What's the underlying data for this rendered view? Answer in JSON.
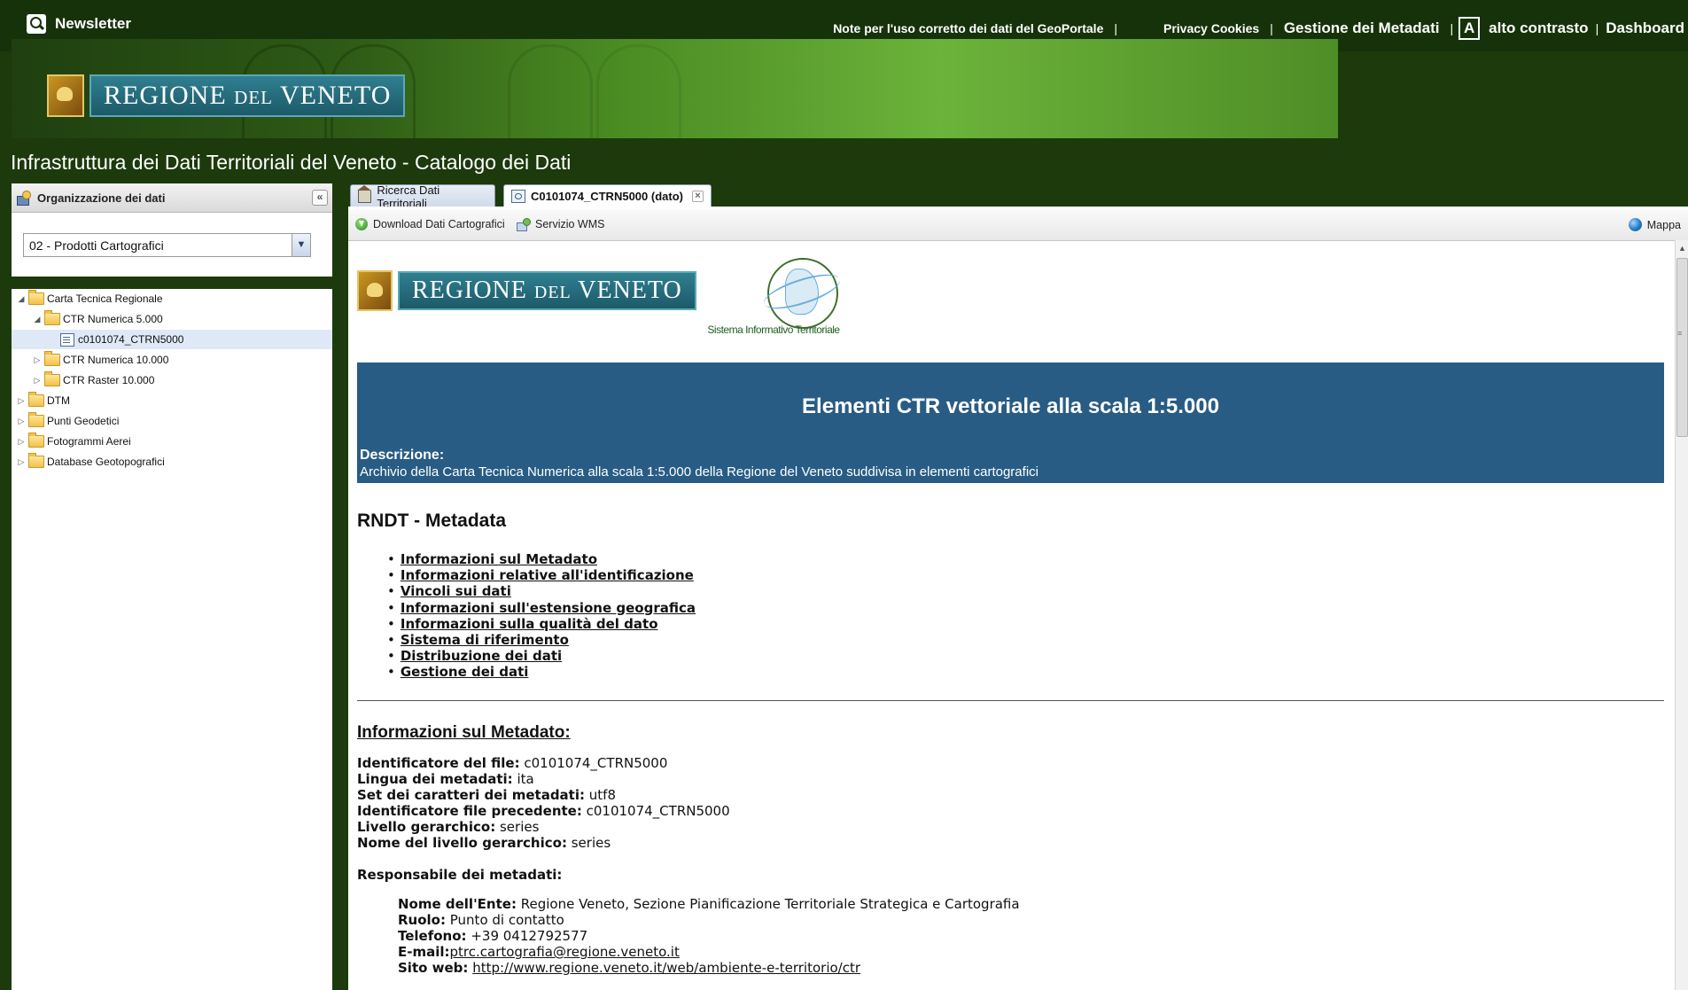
{
  "topbar": {
    "newsletter": "Newsletter",
    "links": [
      "Note per l'uso corretto dei dati del GeoPortale",
      "Privacy Cookies",
      "Gestione dei Metadati",
      "alto contrasto",
      "Dashboard"
    ],
    "contrast_icon": "A"
  },
  "banner": {
    "logo_main": "REGIONE",
    "logo_small": "DEL",
    "logo_end": "VENETO"
  },
  "page_title": "Infrastruttura dei Dati Territoriali del Veneto - Catalogo dei Dati",
  "sidebar": {
    "header": "Organizzazione dei dati",
    "collapse": "«",
    "select_value": "02 - Prodotti Cartografici",
    "tree": [
      {
        "label": "Carta Tecnica Regionale",
        "level": 0,
        "expanded": true,
        "type": "folder"
      },
      {
        "label": "CTR Numerica 5.000",
        "level": 1,
        "expanded": true,
        "type": "folder"
      },
      {
        "label": "c0101074_CTRN5000",
        "level": 2,
        "type": "leaf",
        "selected": true
      },
      {
        "label": "CTR Numerica 10.000",
        "level": 1,
        "expanded": false,
        "type": "folder"
      },
      {
        "label": "CTR Raster 10.000",
        "level": 1,
        "expanded": false,
        "type": "folder"
      },
      {
        "label": "DTM",
        "level": 0,
        "expanded": false,
        "type": "folder"
      },
      {
        "label": "Punti Geodetici",
        "level": 0,
        "expanded": false,
        "type": "folder"
      },
      {
        "label": "Fotogrammi Aerei",
        "level": 0,
        "expanded": false,
        "type": "folder"
      },
      {
        "label": "Database Geotopografici",
        "level": 0,
        "expanded": false,
        "type": "folder"
      }
    ]
  },
  "tabs": [
    {
      "label": "Ricerca Dati Territoriali"
    },
    {
      "label": "C0101074_CTRN5000 (dato)"
    }
  ],
  "toolbar": {
    "download": "Download Dati Cartografici",
    "wms": "Servizio WMS",
    "map": "Mappa"
  },
  "document": {
    "sit_label": "Sistema Informativo Territoriale",
    "hero_title": "Elementi CTR vettoriale alla scala 1:5.000",
    "desc_label": "Descrizione:",
    "desc_text": "Archivio della Carta Tecnica Numerica alla scala 1:5.000 della Regione del Veneto suddivisa in elementi cartografici",
    "rndt_title": "RNDT - Metadata",
    "toc": [
      "Informazioni sul Metadato",
      "Informazioni relative all'identificazione",
      "Vincoli sui dati",
      "Informazioni sull'estensione geografica",
      "Informazioni sulla qualità del dato",
      "Sistema di riferimento",
      "Distribuzione dei dati",
      "Gestione dei dati"
    ],
    "info_title": "Informazioni sul Metadato:",
    "fields": [
      {
        "k": "Identificatore del file:",
        "v": "c0101074_CTRN5000"
      },
      {
        "k": "Lingua dei metadati:",
        "v": "ita"
      },
      {
        "k": "Set dei caratteri dei metadati:",
        "v": "utf8"
      },
      {
        "k": "Identificatore file precedente:",
        "v": "c0101074_CTRN5000"
      },
      {
        "k": "Livello gerarchico:",
        "v": "series"
      },
      {
        "k": "Nome del livello gerarchico:",
        "v": "series"
      }
    ],
    "resp_title": "Responsabile dei metadati:",
    "resp": [
      {
        "k": "Nome dell'Ente:",
        "v": "Regione Veneto, Sezione Pianificazione Territoriale Strategica e Cartografia"
      },
      {
        "k": "Ruolo:",
        "v": "Punto di contatto"
      },
      {
        "k": "Telefono:",
        "v": "+39 0412792577"
      },
      {
        "k": "E-mail:",
        "v": "ptrc.cartografia@regione.veneto.it"
      },
      {
        "k": "Sito web:",
        "v": "http://www.regione.veneto.it/web/ambiente-e-territorio/ctr"
      }
    ]
  }
}
